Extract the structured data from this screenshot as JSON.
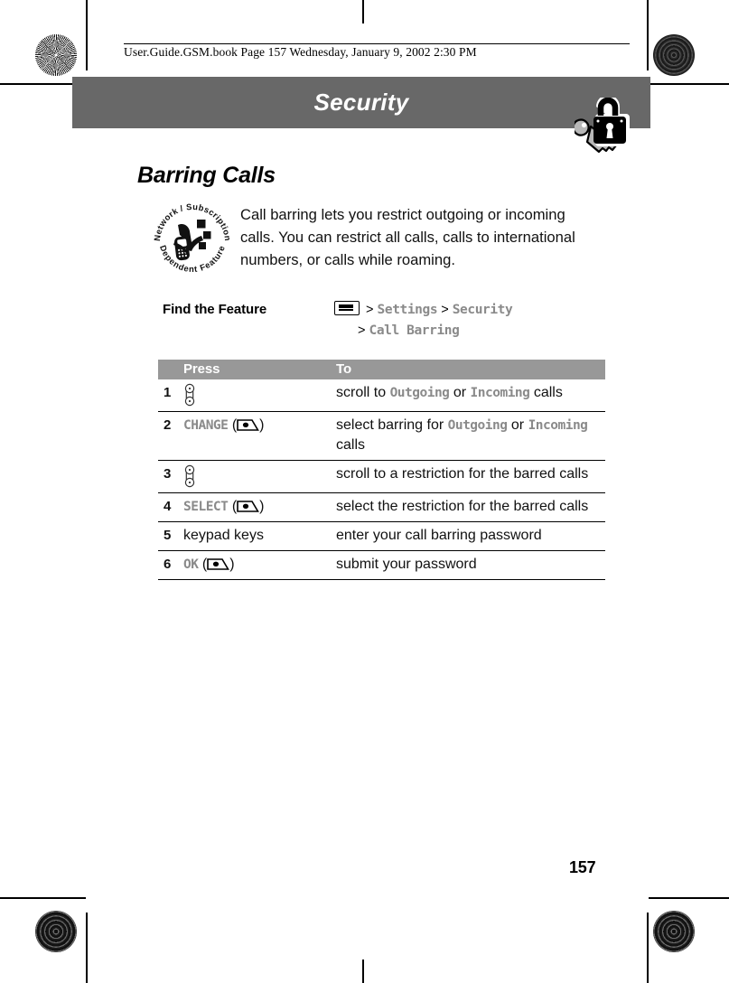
{
  "document": {
    "filebar": "User.Guide.GSM.book  Page 157  Wednesday, January 9, 2002  2:30 PM",
    "page_number": "157",
    "chapter_title": "Security",
    "chapter_icon": "padlock-key-icon"
  },
  "section": {
    "heading": "Barring Calls",
    "badge_icon": "network-subscription-dependent-feature-badge",
    "badge_text_top": "Network / Subscription",
    "badge_text_bottom": "Dependent Feature",
    "intro": "Call barring lets you restrict outgoing or incoming calls. You can restrict all calls, calls to international numbers, or calls while roaming."
  },
  "find_the_feature": {
    "label": "Find the Feature",
    "menu_icon": "menu-key-icon",
    "path_line1": [
      {
        "type": "sep",
        "text": ">"
      },
      {
        "type": "mono",
        "text": "Settings"
      },
      {
        "type": "sep",
        "text": ">"
      },
      {
        "type": "mono",
        "text": "Security"
      }
    ],
    "path_line2": [
      {
        "type": "sep",
        "text": ">"
      },
      {
        "type": "mono",
        "text": "Call Barring"
      }
    ]
  },
  "table": {
    "headers": {
      "num": "",
      "press": "Press",
      "to": "To"
    },
    "rows": [
      {
        "num": "1",
        "press_icon": "scroll-key-icon",
        "press_text": "",
        "press_suffix": "",
        "to_parts": [
          {
            "type": "text",
            "text": "scroll to "
          },
          {
            "type": "mono",
            "text": "Outgoing"
          },
          {
            "type": "text",
            "text": " or "
          },
          {
            "type": "mono",
            "text": "Incoming"
          },
          {
            "type": "text",
            "text": " calls"
          }
        ]
      },
      {
        "num": "2",
        "press_icon": "soft-key-icon",
        "press_text": "CHANGE",
        "press_suffix": "",
        "to_parts": [
          {
            "type": "text",
            "text": "select barring for "
          },
          {
            "type": "mono",
            "text": "Outgoing"
          },
          {
            "type": "text",
            "text": " or "
          },
          {
            "type": "mono",
            "text": "Incoming"
          },
          {
            "type": "text",
            "text": " calls"
          }
        ]
      },
      {
        "num": "3",
        "press_icon": "scroll-key-icon",
        "press_text": "",
        "press_suffix": "",
        "to_parts": [
          {
            "type": "text",
            "text": "scroll to a restriction for the barred calls"
          }
        ]
      },
      {
        "num": "4",
        "press_icon": "soft-key-icon",
        "press_text": "SELECT",
        "press_suffix": "",
        "to_parts": [
          {
            "type": "text",
            "text": "select the restriction for the barred calls"
          }
        ]
      },
      {
        "num": "5",
        "press_icon": "",
        "press_text": "keypad keys",
        "press_suffix": "",
        "to_parts": [
          {
            "type": "text",
            "text": "enter your call barring password"
          }
        ]
      },
      {
        "num": "6",
        "press_icon": "soft-key-icon",
        "press_text": "OK",
        "press_suffix": "",
        "to_parts": [
          {
            "type": "text",
            "text": "submit your password"
          }
        ]
      }
    ]
  },
  "colors": {
    "banner_gray": "#686868",
    "table_header_gray": "#989898",
    "mono_gray": "#8a8a8a"
  }
}
